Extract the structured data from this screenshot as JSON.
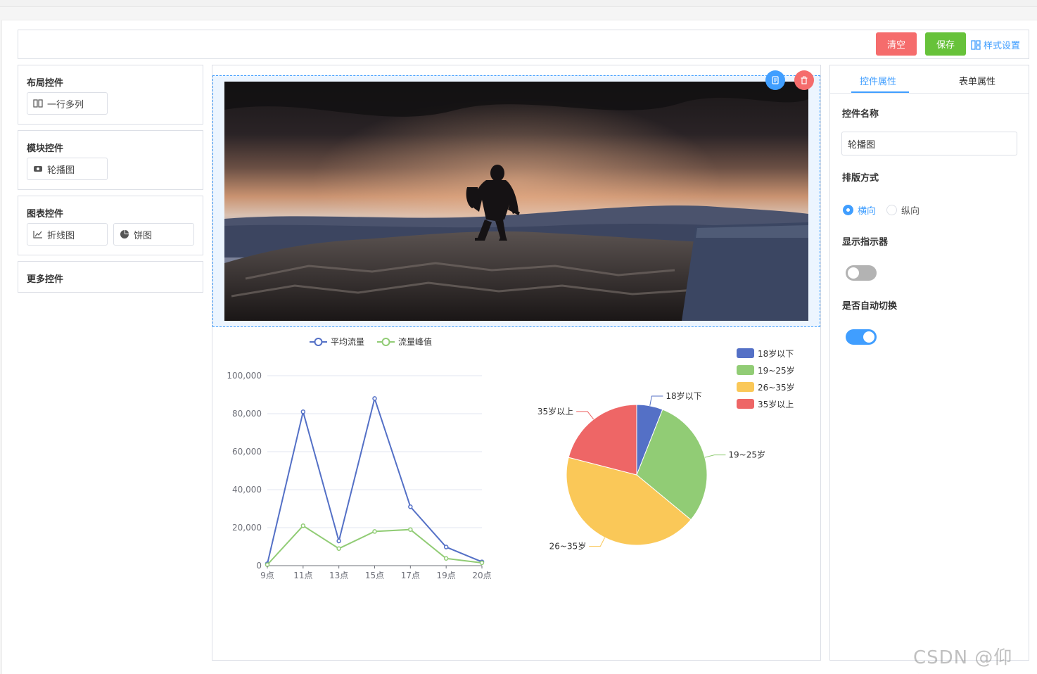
{
  "toolbar": {
    "clear_label": "清空",
    "save_label": "保存",
    "style_label": "样式设置"
  },
  "palette": {
    "groups": [
      {
        "title": "布局控件",
        "items": [
          {
            "label": "一行多列",
            "icon": "columns-icon"
          }
        ]
      },
      {
        "title": "模块控件",
        "items": [
          {
            "label": "轮播图",
            "icon": "image-icon"
          }
        ]
      },
      {
        "title": "图表控件",
        "items": [
          {
            "label": "折线图",
            "icon": "line-chart-icon"
          },
          {
            "label": "饼图",
            "icon": "pie-chart-icon"
          }
        ]
      },
      {
        "title": "更多控件",
        "items": []
      }
    ]
  },
  "properties": {
    "tabs": [
      {
        "label": "控件属性",
        "active": true
      },
      {
        "label": "表单属性",
        "active": false
      }
    ],
    "name_label": "控件名称",
    "name_value": "轮播图",
    "layout_label": "排版方式",
    "layout_options": [
      {
        "label": "横向",
        "selected": true
      },
      {
        "label": "纵向",
        "selected": false
      }
    ],
    "indicator_label": "显示指示器",
    "indicator_on": false,
    "autoplay_label": "是否自动切换",
    "autoplay_on": true
  },
  "colors": {
    "primary": "#409eff",
    "danger": "#f56c6c",
    "success": "#67c23a",
    "line_series_1": "#5470c6",
    "line_series_2": "#91cc75",
    "pie": [
      "#5470c6",
      "#91cc75",
      "#fac858",
      "#ee6666"
    ]
  },
  "watermark": "CSDN @仰望.",
  "chart_data": [
    {
      "type": "line",
      "categories": [
        "9点",
        "11点",
        "13点",
        "15点",
        "17点",
        "19点",
        "20点"
      ],
      "series": [
        {
          "name": "平均流量",
          "values": [
            1000,
            81000,
            13000,
            88000,
            31000,
            9800,
            2000
          ]
        },
        {
          "name": "流量峰值",
          "values": [
            500,
            21000,
            9000,
            18000,
            19000,
            3800,
            1500
          ]
        }
      ],
      "yticks": [
        "0",
        "20,000",
        "40,000",
        "60,000",
        "80,000",
        "100,000"
      ],
      "ylim": [
        0,
        100000
      ],
      "legend": "top-center",
      "grid": true
    },
    {
      "type": "pie",
      "labels": [
        "18岁以下",
        "19~25岁",
        "26~35岁",
        "35岁以上"
      ],
      "values": [
        6,
        30,
        43,
        21
      ],
      "legend": "top-right"
    }
  ]
}
